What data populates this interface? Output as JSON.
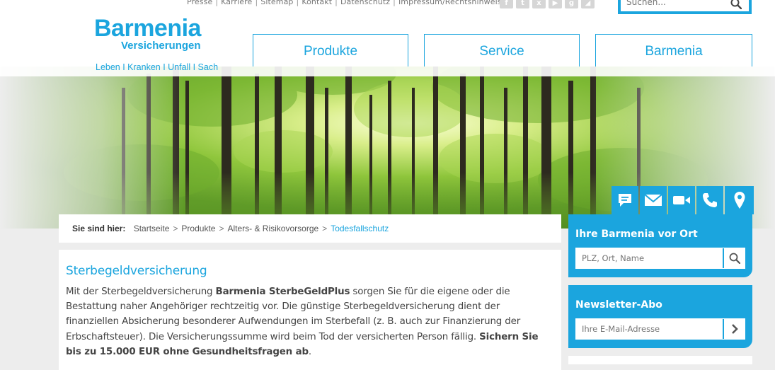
{
  "top_links": [
    "Presse",
    "Karriere",
    "Sitemap",
    "Kontakt",
    "Datenschutz",
    "Impressum/Rechtshinweise"
  ],
  "search": {
    "placeholder": "Suchen..."
  },
  "logo": {
    "brand": "Barmenia",
    "sub": "Versicherungen",
    "tagline": "Leben I Kranken I Unfall I Sach"
  },
  "nav": {
    "produkte": "Produkte",
    "service": "Service",
    "barmenia": "Barmenia"
  },
  "breadcrumb": {
    "label": "Sie sind hier:",
    "items": [
      "Startseite",
      "Produkte",
      "Alters- & Risikovorsorge"
    ],
    "current": "Todesfallschutz"
  },
  "article": {
    "title": "Sterbegeldversicherung",
    "p1": "Mit der Sterbegeldversicherung ",
    "p1_bold": "Barmenia SterbeGeldPlus",
    "p1_rest": " sorgen Sie für die eigene oder die Bestattung naher Angehöriger rechtzeitig vor. Die günstige Sterbegeldversicherung dient der finanziellen Absicherung besonderer Aufwendungen im Sterbefall (z. B. auch zur Finanzierung der Erbschaftsteuer). Die Versicherungssumme wird beim Tod der versicherten Person fällig. ",
    "p1_bold2": "Sichern Sie bis zu 15.000 EUR ohne Gesundheitsfragen ab",
    "p1_end": "."
  },
  "sidebar": {
    "local": {
      "title": "Ihre Barmenia vor Ort",
      "placeholder": "PLZ, Ort, Name"
    },
    "newsletter": {
      "title": "Newsletter-Abo",
      "placeholder": "Ihre E-Mail-Adresse"
    }
  },
  "colors": {
    "accent": "#1ba5de",
    "background": "#ededed"
  }
}
